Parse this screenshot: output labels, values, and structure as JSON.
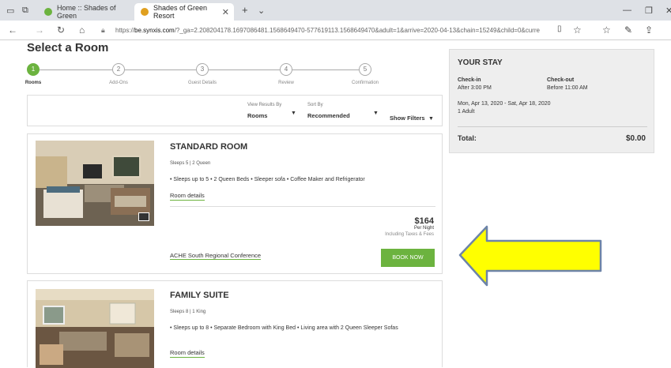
{
  "browser": {
    "tabs": [
      {
        "label": "Home :: Shades of Green",
        "active": false
      },
      {
        "label": "Shades of Green Resort",
        "active": true
      }
    ],
    "new_tab": "+",
    "url_prefix": "https://",
    "url_host": "be.synxis.com",
    "url_rest": "/?_ga=2.208204178.1697086481.1568649470-577619113.1568649470&adult=1&arrive=2020-04-13&chain=15249&child=0&curre"
  },
  "page": {
    "title": "Select a Room",
    "steps": [
      {
        "num": "1",
        "label": "Rooms",
        "active": true
      },
      {
        "num": "2",
        "label": "Add-Ons",
        "active": false
      },
      {
        "num": "3",
        "label": "Guest Details",
        "active": false
      },
      {
        "num": "4",
        "label": "Review",
        "active": false
      },
      {
        "num": "5",
        "label": "Confirmation",
        "active": false
      }
    ],
    "filters": {
      "view_label": "View Results By",
      "view_value": "Rooms",
      "sort_label": "Sort By",
      "sort_value": "Recommended",
      "show_filters": "Show Filters"
    }
  },
  "rooms": [
    {
      "title": "STANDARD ROOM",
      "meta": "Sleeps 5  |  2 Queen",
      "desc": "• Sleeps up to 5 • 2 Queen Beds • Sleeper sofa • Coffee Maker and Refrigerator",
      "details_link": "Room details",
      "price": "$164",
      "per_night": "Per Night",
      "taxes": "Including Taxes & Fees",
      "rate_name": "ACHE South Regional Conference",
      "book_label": "BOOK NOW"
    },
    {
      "title": "FAMILY SUITE",
      "meta": "Sleeps 8  |  1 King",
      "desc": "• Sleeps up to 8 • Separate Bedroom with King Bed • Living area with 2 Queen Sleeper Sofas",
      "details_link": "Room details"
    }
  ],
  "stay": {
    "title": "YOUR STAY",
    "checkin_label": "Check-in",
    "checkin_value": "After 3:00 PM",
    "checkout_label": "Check-out",
    "checkout_value": "Before 11:00 AM",
    "dates": "Mon, Apr 13, 2020 - Sat, Apr 18, 2020",
    "guests": "1 Adult",
    "total_label": "Total:",
    "total_value": "$0.00"
  },
  "colors": {
    "accent_green": "#6cb33f",
    "annotation_arrow": "#ffff00"
  }
}
